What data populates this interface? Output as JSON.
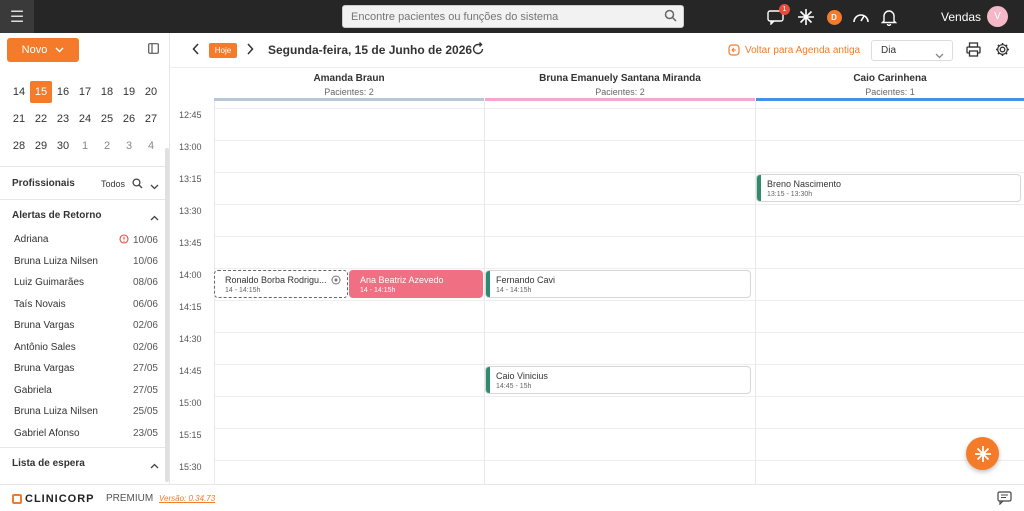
{
  "topbar": {
    "search_placeholder": "Encontre pacientes ou funções do sistema",
    "notification_count": "1",
    "record_glyph": "D",
    "user_label": "Vendas",
    "avatar_initial": "V"
  },
  "sidebar": {
    "new_button": "Novo",
    "calendar_rows": [
      [
        {
          "d": "14"
        },
        {
          "d": "15",
          "selected": true
        },
        {
          "d": "16"
        },
        {
          "d": "17"
        },
        {
          "d": "18"
        },
        {
          "d": "19"
        },
        {
          "d": "20"
        }
      ],
      [
        {
          "d": "21"
        },
        {
          "d": "22"
        },
        {
          "d": "23"
        },
        {
          "d": "24"
        },
        {
          "d": "25"
        },
        {
          "d": "26"
        },
        {
          "d": "27"
        }
      ],
      [
        {
          "d": "28"
        },
        {
          "d": "29"
        },
        {
          "d": "30"
        },
        {
          "d": "1",
          "muted": true
        },
        {
          "d": "2",
          "muted": true
        },
        {
          "d": "3",
          "muted": true
        },
        {
          "d": "4",
          "muted": true
        }
      ]
    ],
    "profissionais_title": "Profissionais",
    "profissionais_filter": "Todos",
    "alertas_title": "Alertas de Retorno",
    "alerts": [
      {
        "name": "Adriana",
        "date": "10/06",
        "warning": true
      },
      {
        "name": "Bruna Luiza Nilsen",
        "date": "10/06"
      },
      {
        "name": "Luiz Guimarães",
        "date": "08/06"
      },
      {
        "name": "Taís Novais",
        "date": "06/06"
      },
      {
        "name": "Bruna Vargas",
        "date": "02/06"
      },
      {
        "name": "Antônio Sales",
        "date": "02/06"
      },
      {
        "name": "Bruna Vargas",
        "date": "27/05"
      },
      {
        "name": "Gabriela",
        "date": "27/05"
      },
      {
        "name": "Bruna Luiza Nilsen",
        "date": "25/05"
      },
      {
        "name": "Gabriel Afonso",
        "date": "23/05"
      }
    ],
    "espera_title": "Lista de espera"
  },
  "toolbar": {
    "today_button": "Hoje",
    "date_title": "Segunda-feira, 15 de Junho de 2026",
    "back_link": "Voltar para Agenda antiga",
    "view_select": "Dia"
  },
  "columns": [
    {
      "name": "Amanda Braun",
      "patients": "Pacientes: 2",
      "color": "#b8c6d6"
    },
    {
      "name": "Bruna Emanuely Santana Miranda",
      "patients": "Pacientes: 2",
      "color": "#f4a6d0"
    },
    {
      "name": "Caio Carinhena",
      "patients": "Pacientes: 1",
      "color": "#4a90e2"
    }
  ],
  "times": [
    "12:45",
    "13:00",
    "13:15",
    "13:30",
    "13:45",
    "14:00",
    "14:15",
    "14:30",
    "14:45",
    "15:00",
    "15:15",
    "15:30"
  ],
  "appointments": [
    {
      "name": "Ronaldo Borba Rodrigu...",
      "time": "14 - 14:15h",
      "style": "dashed"
    },
    {
      "name": "Ana Beatriz Azevedo",
      "time": "14 - 14:15h",
      "style": "pink"
    },
    {
      "name": "Fernando Cavi",
      "time": "14 - 14:15h",
      "style": "stripe"
    },
    {
      "name": "Caio Vinicius",
      "time": "14:45 - 15h",
      "style": "stripe"
    },
    {
      "name": "Breno Nascimento",
      "time": "13:15 - 13:30h",
      "style": "stripe"
    }
  ],
  "footer": {
    "brand": "CLINICORP",
    "plan": "PREMIUM",
    "version": "Versão: 0.34.73"
  },
  "colors": {
    "accent": "#f47b2a",
    "topbar": "#262626",
    "appointment_pink": "#f06f83",
    "appointment_stripe": "#2e8b6e"
  }
}
